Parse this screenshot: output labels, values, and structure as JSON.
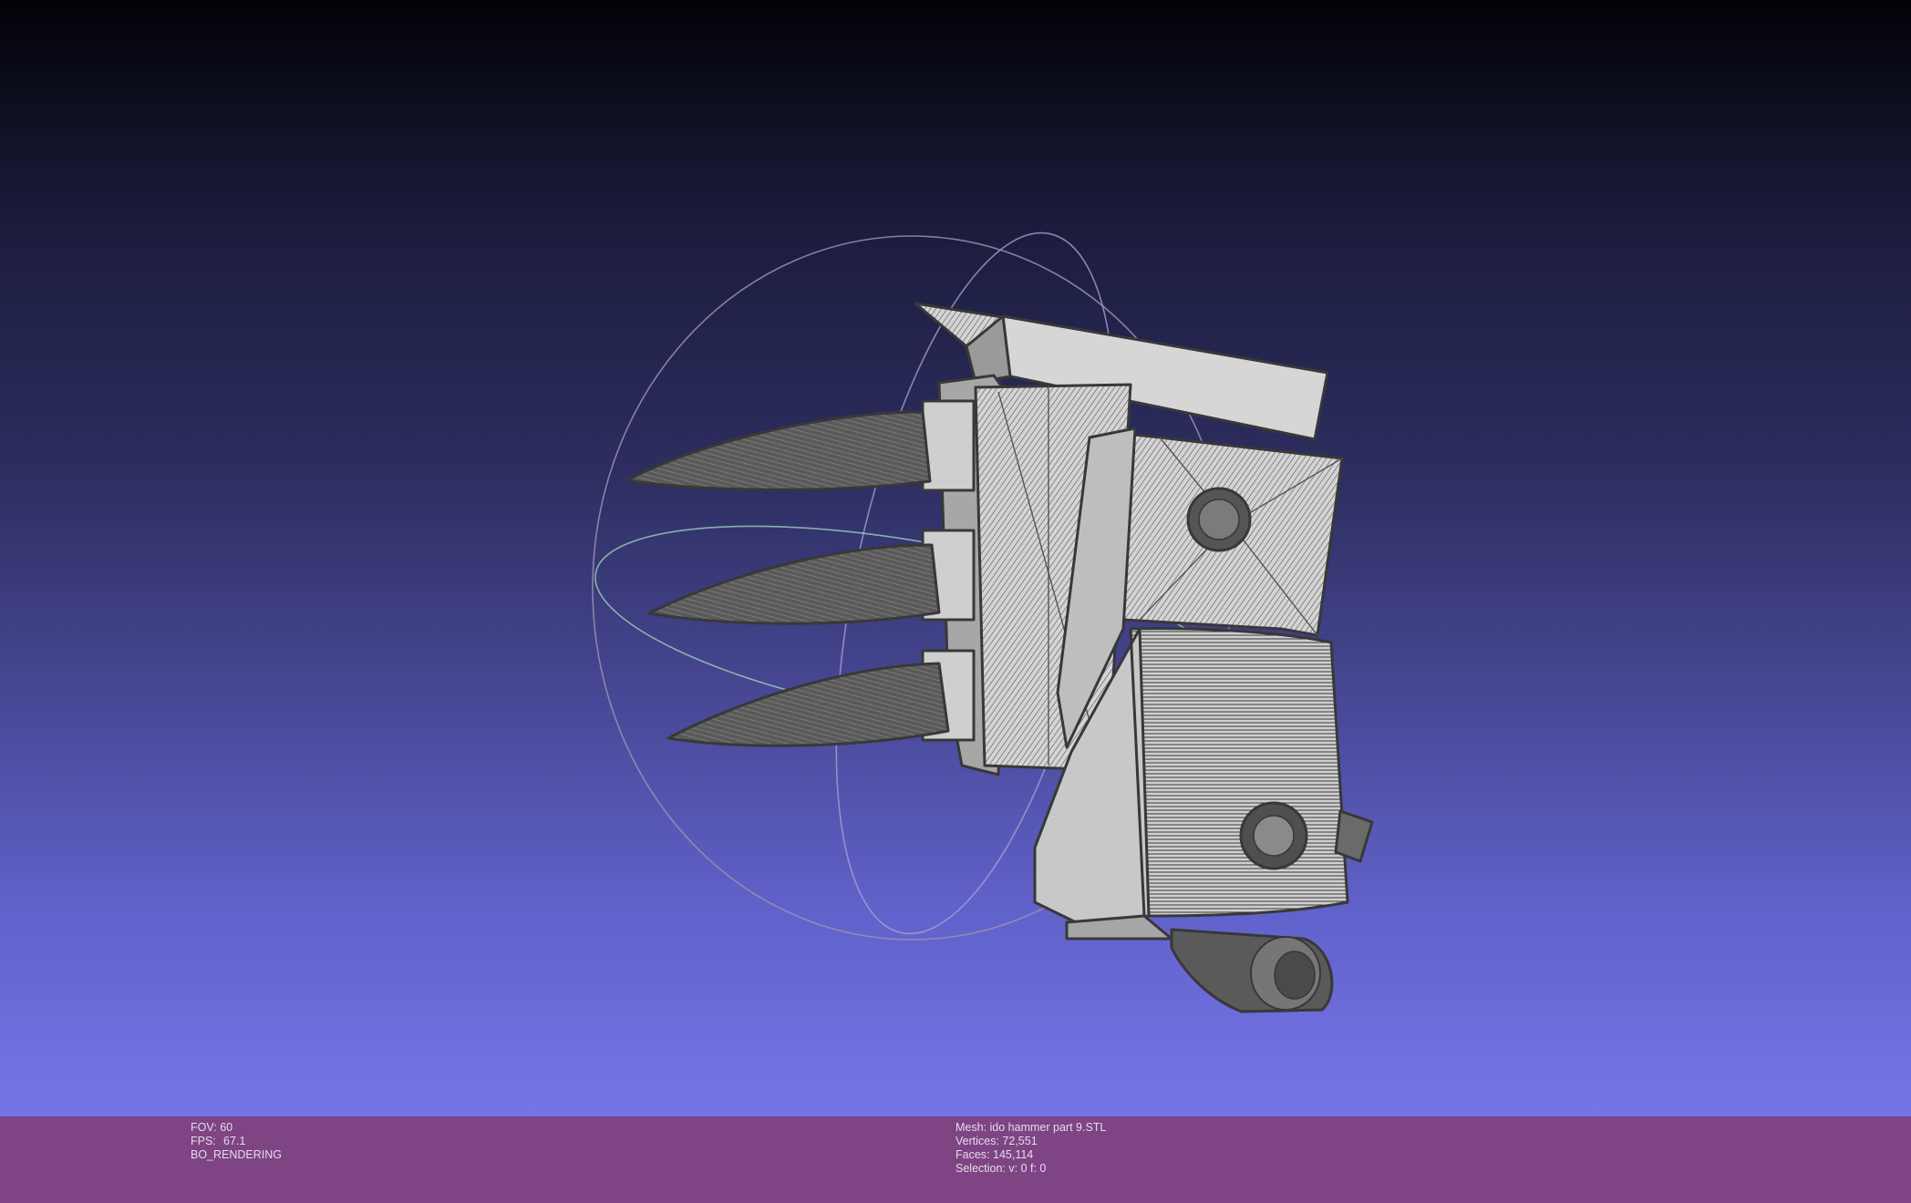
{
  "window": {
    "colors": {
      "background_top": "#020207",
      "background_bottom": "#7575e8",
      "info_bar": "#7e4484",
      "info_text": "#e6dcea",
      "mesh_fill": "#d9d9d9",
      "mesh_wire": "#3c3c3c"
    }
  },
  "viewport": {
    "model_name": "mesh-model",
    "trackball_icon": "trackball-icon"
  },
  "info_left": {
    "fov_label": "FOV:",
    "fov_value": "60",
    "fps_label": "FPS:",
    "fps_value": "67.1",
    "render_mode": "BO_RENDERING"
  },
  "info_right": {
    "mesh_label": "Mesh:",
    "mesh_name": "ido hammer part 9.STL",
    "vertices_label": "Vertices:",
    "vertices_value": "72,551",
    "faces_label": "Faces:",
    "faces_value": "145,114",
    "selection_label": "Selection:",
    "selection_value": "v: 0 f: 0"
  }
}
